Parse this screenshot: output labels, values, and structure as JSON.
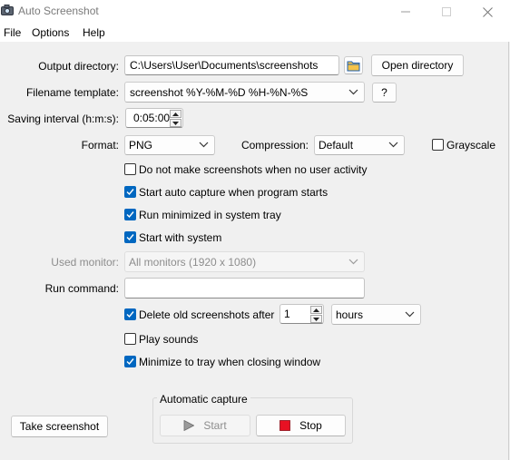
{
  "window": {
    "title": "Auto Screenshot",
    "app_icon": "camera-icon",
    "controls": [
      "minimize-icon",
      "maximize-icon",
      "close-icon"
    ]
  },
  "menu": {
    "items": [
      "File",
      "Options",
      "Help"
    ]
  },
  "output": {
    "label": "Output directory:",
    "value": "C:\\Users\\User\\Documents\\screenshots",
    "browse_icon": "folder-icon",
    "open_button": "Open directory"
  },
  "filename": {
    "label": "Filename template:",
    "value": "screenshot %Y-%M-%D %H-%N-%S",
    "help_button": "?"
  },
  "interval": {
    "label": "Saving interval (h:m:s):",
    "value": "0:05:00"
  },
  "format": {
    "label": "Format:",
    "value": "PNG"
  },
  "compression": {
    "label": "Compression:",
    "value": "Default"
  },
  "grayscale": {
    "label": "Grayscale",
    "checked": false
  },
  "options": [
    {
      "label": "Do not make screenshots when no user activity",
      "checked": false
    },
    {
      "label": "Start auto capture when program starts",
      "checked": true
    },
    {
      "label": "Run minimized in system tray",
      "checked": true
    },
    {
      "label": "Start with system",
      "checked": true
    }
  ],
  "monitor": {
    "label": "Used monitor:",
    "value": "All monitors (1920 x 1080)",
    "enabled": false
  },
  "run_command": {
    "label": "Run command:",
    "value": ""
  },
  "delete_old": {
    "label": "Delete old screenshots after",
    "checked": true,
    "amount": "1",
    "unit": "hours"
  },
  "play_sounds": {
    "label": "Play sounds",
    "checked": false
  },
  "minimize_tray": {
    "label": "Minimize to tray when closing window",
    "checked": true
  },
  "take_screenshot": {
    "label": "Take screenshot"
  },
  "auto_capture": {
    "title": "Automatic capture",
    "start_label": "Start",
    "start_enabled": false,
    "stop_label": "Stop"
  },
  "colors": {
    "accent": "#0067c0",
    "stop_red": "#e81123",
    "disabled_text": "#8d8d8d"
  }
}
